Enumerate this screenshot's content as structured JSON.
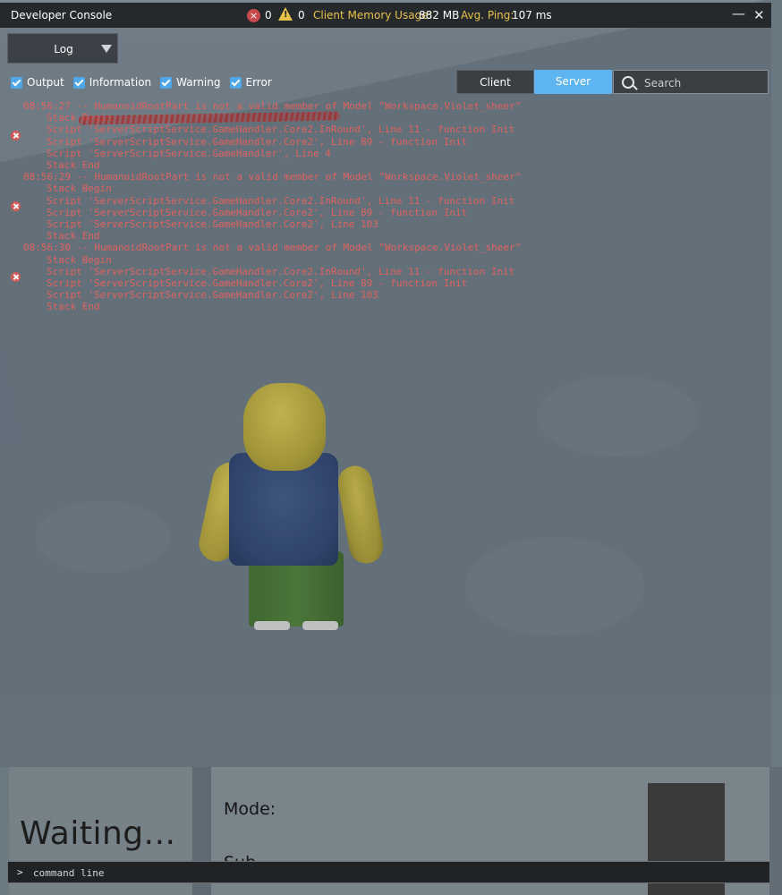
{
  "console": {
    "title": "Developer Console",
    "error_count": "0",
    "warning_count": "0",
    "memory_label": "Client Memory Usage:",
    "memory_value": "882 MB",
    "ping_label": "Avg. Ping:",
    "ping_value": "107 ms",
    "minimize_glyph": "—",
    "close_glyph": "✕",
    "view_dropdown": "Log",
    "filters": [
      {
        "label": "Output",
        "checked": true
      },
      {
        "label": "Information",
        "checked": true
      },
      {
        "label": "Warning",
        "checked": true
      },
      {
        "label": "Error",
        "checked": true
      }
    ],
    "tabs": {
      "client": "Client",
      "server": "Server",
      "active": "server"
    },
    "search_placeholder": "Search",
    "command_prompt": ">",
    "command_placeholder": "command line",
    "colors": {
      "error_text": "#e0625f",
      "active_tab": "#5eb4f1",
      "memory_label": "#e8c14a",
      "ping_label": "#e8c14a"
    }
  },
  "log_entries": [
    {
      "header": "08:56:27 -- HumanoidRootPart is not a valid member of Model \"Workspace.Violet_sheer\"",
      "lines": [
        "Stack Begin",
        "Script 'ServerScriptService.GameHandler.Core2.InRound', Line 11 - function Init",
        "Script 'ServerScriptService.GameHandler.Core2', Line 89 - function Init",
        "Script 'ServerScriptService.GameHandler', Line 4",
        "Stack End"
      ]
    },
    {
      "header": "08:56:29 -- HumanoidRootPart is not a valid member of Model \"Workspace.Violet_sheer\"",
      "lines": [
        "Stack Begin",
        "Script 'ServerScriptService.GameHandler.Core2.InRound', Line 11 - function Init",
        "Script 'ServerScriptService.GameHandler.Core2', Line 89 - function Init",
        "Script 'ServerScriptService.GameHandler.Core2', Line 103",
        "Stack End"
      ]
    },
    {
      "header": "08:56:30 -- HumanoidRootPart is not a valid member of Model \"Workspace.Violet_sheer\"",
      "lines": [
        "Stack Begin",
        "Script 'ServerScriptService.GameHandler.Core2.InRound', Line 11 - function Init",
        "Script 'ServerScriptService.GameHandler.Core2', Line 89 - function Init",
        "Script 'ServerScriptService.GameHandler.Core2', Line 103",
        "Stack End"
      ]
    }
  ],
  "game_ui": {
    "status_text": "Waiting...",
    "mode_label": "Mode:",
    "second_label": "Sub"
  }
}
